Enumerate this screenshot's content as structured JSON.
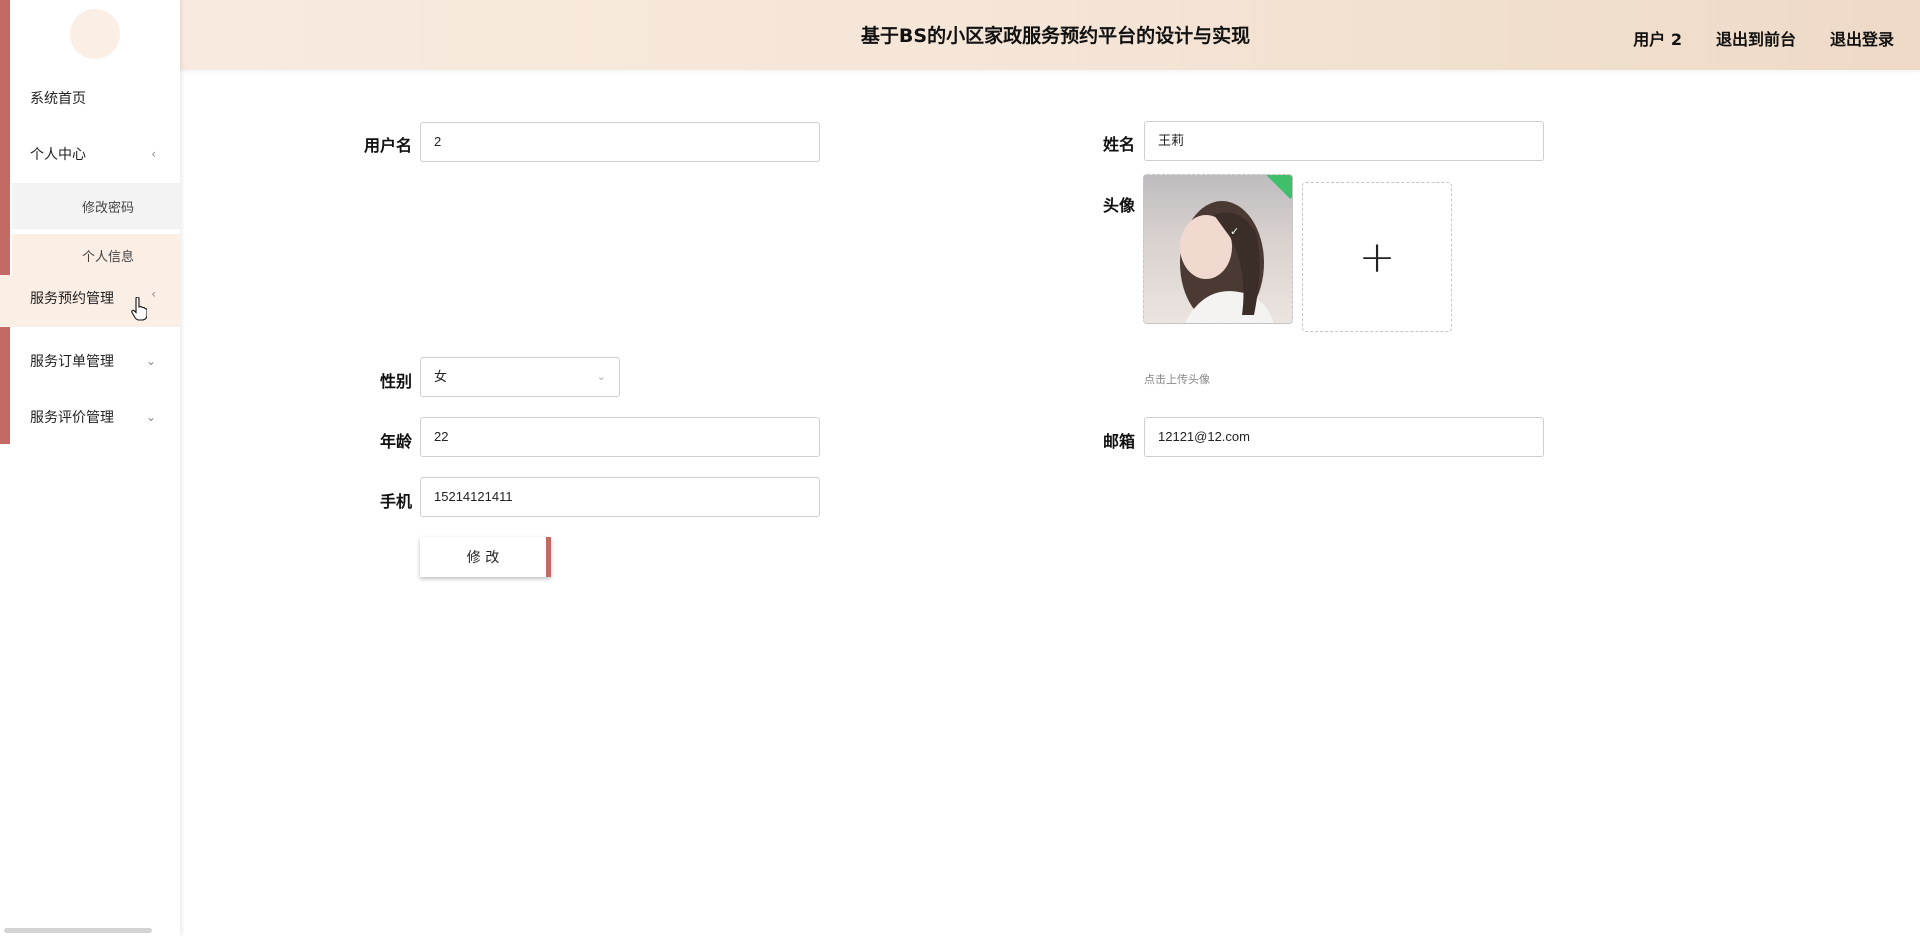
{
  "header": {
    "title": "基于BS的小区家政服务预约平台的设计与实现",
    "user_label": "用户 2",
    "exit_front": "退出到前台",
    "logout": "退出登录"
  },
  "sidebar": {
    "home": "系统首页",
    "personal_center": "个人中心",
    "change_password": "修改密码",
    "personal_info": "个人信息",
    "booking_manage": "服务预约管理",
    "order_manage": "服务订单管理",
    "review_manage": "服务评价管理"
  },
  "form": {
    "username_label": "用户名",
    "username_value": "2",
    "name_label": "姓名",
    "name_value": "王莉",
    "avatar_label": "头像",
    "upload_hint": "点击上传头像",
    "gender_label": "性别",
    "gender_value": "女",
    "age_label": "年龄",
    "age_value": "22",
    "email_label": "邮箱",
    "email_value": "12121@12.com",
    "phone_label": "手机",
    "phone_value": "15214121411",
    "submit_label": "修 改"
  },
  "icons": {
    "collapse": "chevron-left-icon",
    "expand": "chevron-down-icon",
    "upload": "plus-icon",
    "uploaded": "check-icon"
  },
  "colors": {
    "accent": "#c46a64",
    "header_bg": "#f5e5d7",
    "active_menu_bg": "#fbeee4",
    "success_badge": "#3fbf6a"
  }
}
